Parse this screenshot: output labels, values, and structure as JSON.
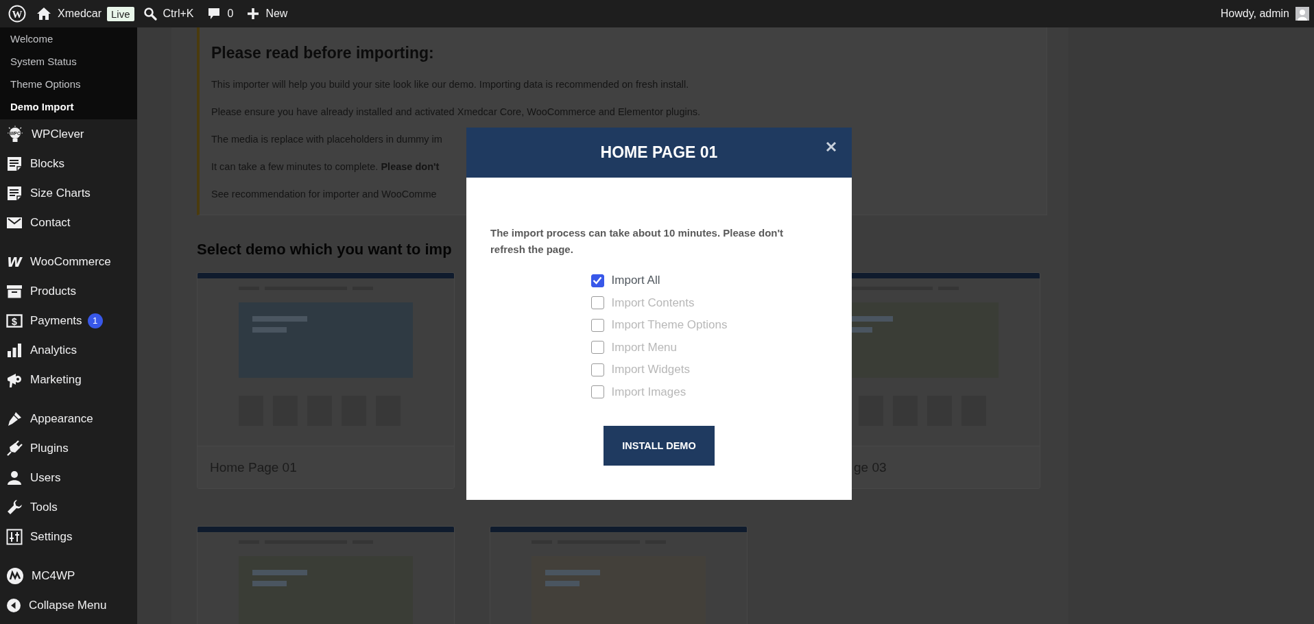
{
  "admin_bar": {
    "logo_letter": "W",
    "site_name": "Xmedcar",
    "live_badge": "Live",
    "search_shortcut": "Ctrl+K",
    "comments_count": "0",
    "new_label": "New",
    "greeting": "Howdy, admin"
  },
  "sidebar": {
    "submenu": [
      {
        "label": "Welcome",
        "selected": false
      },
      {
        "label": "System Status",
        "selected": false
      },
      {
        "label": "Theme Options",
        "selected": false
      },
      {
        "label": "Demo Import",
        "selected": true
      }
    ],
    "groups": [
      {
        "items": [
          {
            "kind": "bulb",
            "icon_text": "WPC",
            "label": "WPClever",
            "selected": false
          },
          {
            "kind": "document",
            "label": "Blocks",
            "selected": false
          },
          {
            "kind": "document",
            "label": "Size Charts",
            "selected": false
          },
          {
            "kind": "envelope",
            "label": "Contact",
            "selected": false
          }
        ]
      },
      {
        "items": [
          {
            "kind": "woo",
            "icon_text": "W",
            "label": "WooCommerce",
            "selected": false
          },
          {
            "kind": "archive",
            "label": "Products",
            "selected": false
          },
          {
            "kind": "dollar",
            "icon_text": "$",
            "label": "Payments",
            "badge": "1",
            "selected": false
          },
          {
            "kind": "chart",
            "label": "Analytics",
            "selected": false
          },
          {
            "kind": "megaphone",
            "label": "Marketing",
            "selected": false
          }
        ]
      },
      {
        "items": [
          {
            "kind": "brush",
            "label": "Appearance",
            "selected": false
          },
          {
            "kind": "plug",
            "label": "Plugins",
            "selected": false
          },
          {
            "kind": "user",
            "label": "Users",
            "selected": false
          },
          {
            "kind": "wrench",
            "label": "Tools",
            "selected": false
          },
          {
            "kind": "sliders",
            "label": "Settings",
            "selected": false
          }
        ]
      },
      {
        "items": [
          {
            "kind": "mc4wp",
            "label": "MC4WP",
            "selected": false
          },
          {
            "kind": "collapse",
            "label": "Collapse Menu",
            "selected": false
          }
        ]
      }
    ]
  },
  "notice": {
    "heading": "Please read before importing:",
    "paragraphs": [
      "This importer will help you build your site look like our demo. Importing data is recommended on fresh install.",
      "Please ensure you have already installed and activated Xmedcar Core, WooCommerce and Elementor plugins.",
      "The media is replace with placeholders in dummy im",
      "It can take a few minutes to complete. **Please don't**",
      "See recommendation for importer and WooComme"
    ]
  },
  "demos": {
    "heading": "Select demo which you want to imp",
    "cards": [
      {
        "label": "Home Page 01"
      },
      {
        "label": "ge 03"
      }
    ]
  },
  "modal": {
    "title": "HOME PAGE 01",
    "message": "The import process can take about 10 minutes. Please don't refresh the page.",
    "options": [
      {
        "label": "Import All",
        "checked": true,
        "disabled": false
      },
      {
        "label": "Import Contents",
        "checked": false,
        "disabled": true
      },
      {
        "label": "Import Theme Options",
        "checked": false,
        "disabled": true
      },
      {
        "label": "Import Menu",
        "checked": false,
        "disabled": true
      },
      {
        "label": "Import Widgets",
        "checked": false,
        "disabled": true
      },
      {
        "label": "Import Images",
        "checked": false,
        "disabled": true
      }
    ],
    "button": "INSTALL DEMO"
  }
}
